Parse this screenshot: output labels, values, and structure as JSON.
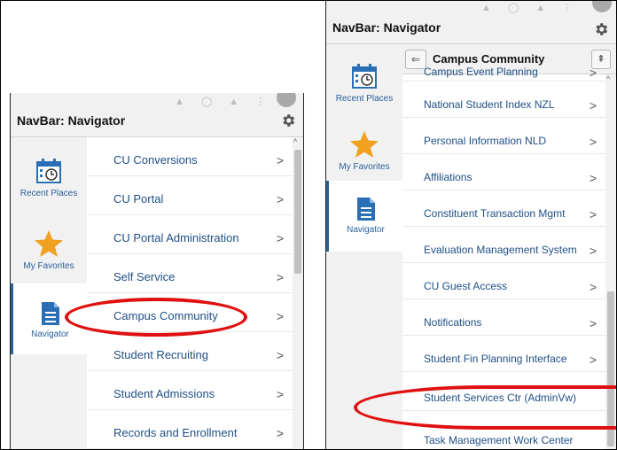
{
  "left_panel": {
    "title": "NavBar: Navigator",
    "sidebar": [
      {
        "label": "Recent Places",
        "icon": "calendar-clock-icon",
        "active": false
      },
      {
        "label": "My Favorites",
        "icon": "star-icon",
        "active": false
      },
      {
        "label": "Navigator",
        "icon": "document-icon",
        "active": true
      }
    ],
    "items": [
      {
        "label": "CU Conversions",
        "chevron": ">"
      },
      {
        "label": "CU Portal",
        "chevron": ">"
      },
      {
        "label": "CU Portal Administration",
        "chevron": ">"
      },
      {
        "label": "Self Service",
        "chevron": ">"
      },
      {
        "label": "Campus Community",
        "chevron": ">"
      },
      {
        "label": "Student Recruiting",
        "chevron": ">"
      },
      {
        "label": "Student Admissions",
        "chevron": ">"
      },
      {
        "label": "Records and Enrollment",
        "chevron": ">"
      }
    ],
    "highlighted_item": "Campus Community"
  },
  "right_panel": {
    "title": "NavBar: Navigator",
    "header": {
      "back_symbol": "⇐",
      "title": "Campus Community",
      "top_symbol": "⇞"
    },
    "sidebar": [
      {
        "label": "Recent Places",
        "icon": "calendar-clock-icon",
        "active": false
      },
      {
        "label": "My Favorites",
        "icon": "star-icon",
        "active": false
      },
      {
        "label": "Navigator",
        "icon": "document-icon",
        "active": true
      }
    ],
    "partial_item": {
      "label": "Campus Event Planning",
      "chevron": ">"
    },
    "items": [
      {
        "label": "National Student Index NZL",
        "chevron": ">"
      },
      {
        "label": "Personal Information NLD",
        "chevron": ">"
      },
      {
        "label": "Affiliations",
        "chevron": ">"
      },
      {
        "label": "Constituent Transaction Mgmt",
        "chevron": ">"
      },
      {
        "label": "Evaluation Management System",
        "chevron": ">"
      },
      {
        "label": "CU Guest Access",
        "chevron": ">"
      },
      {
        "label": "Notifications",
        "chevron": ">"
      },
      {
        "label": "Student Fin Planning Interface",
        "chevron": ">"
      },
      {
        "label": "Student Services Ctr (AdminVw)",
        "chevron": ""
      },
      {
        "label": "Task Management Work Center",
        "chevron": ""
      }
    ],
    "highlighted_item": "Student Services Ctr (AdminVw)"
  },
  "colors": {
    "accent": "#2a5f9a",
    "link": "#1f4e86",
    "highlight": "#e01010",
    "star": "#f0a11f",
    "sidebar_bg": "#f1f1f1"
  }
}
